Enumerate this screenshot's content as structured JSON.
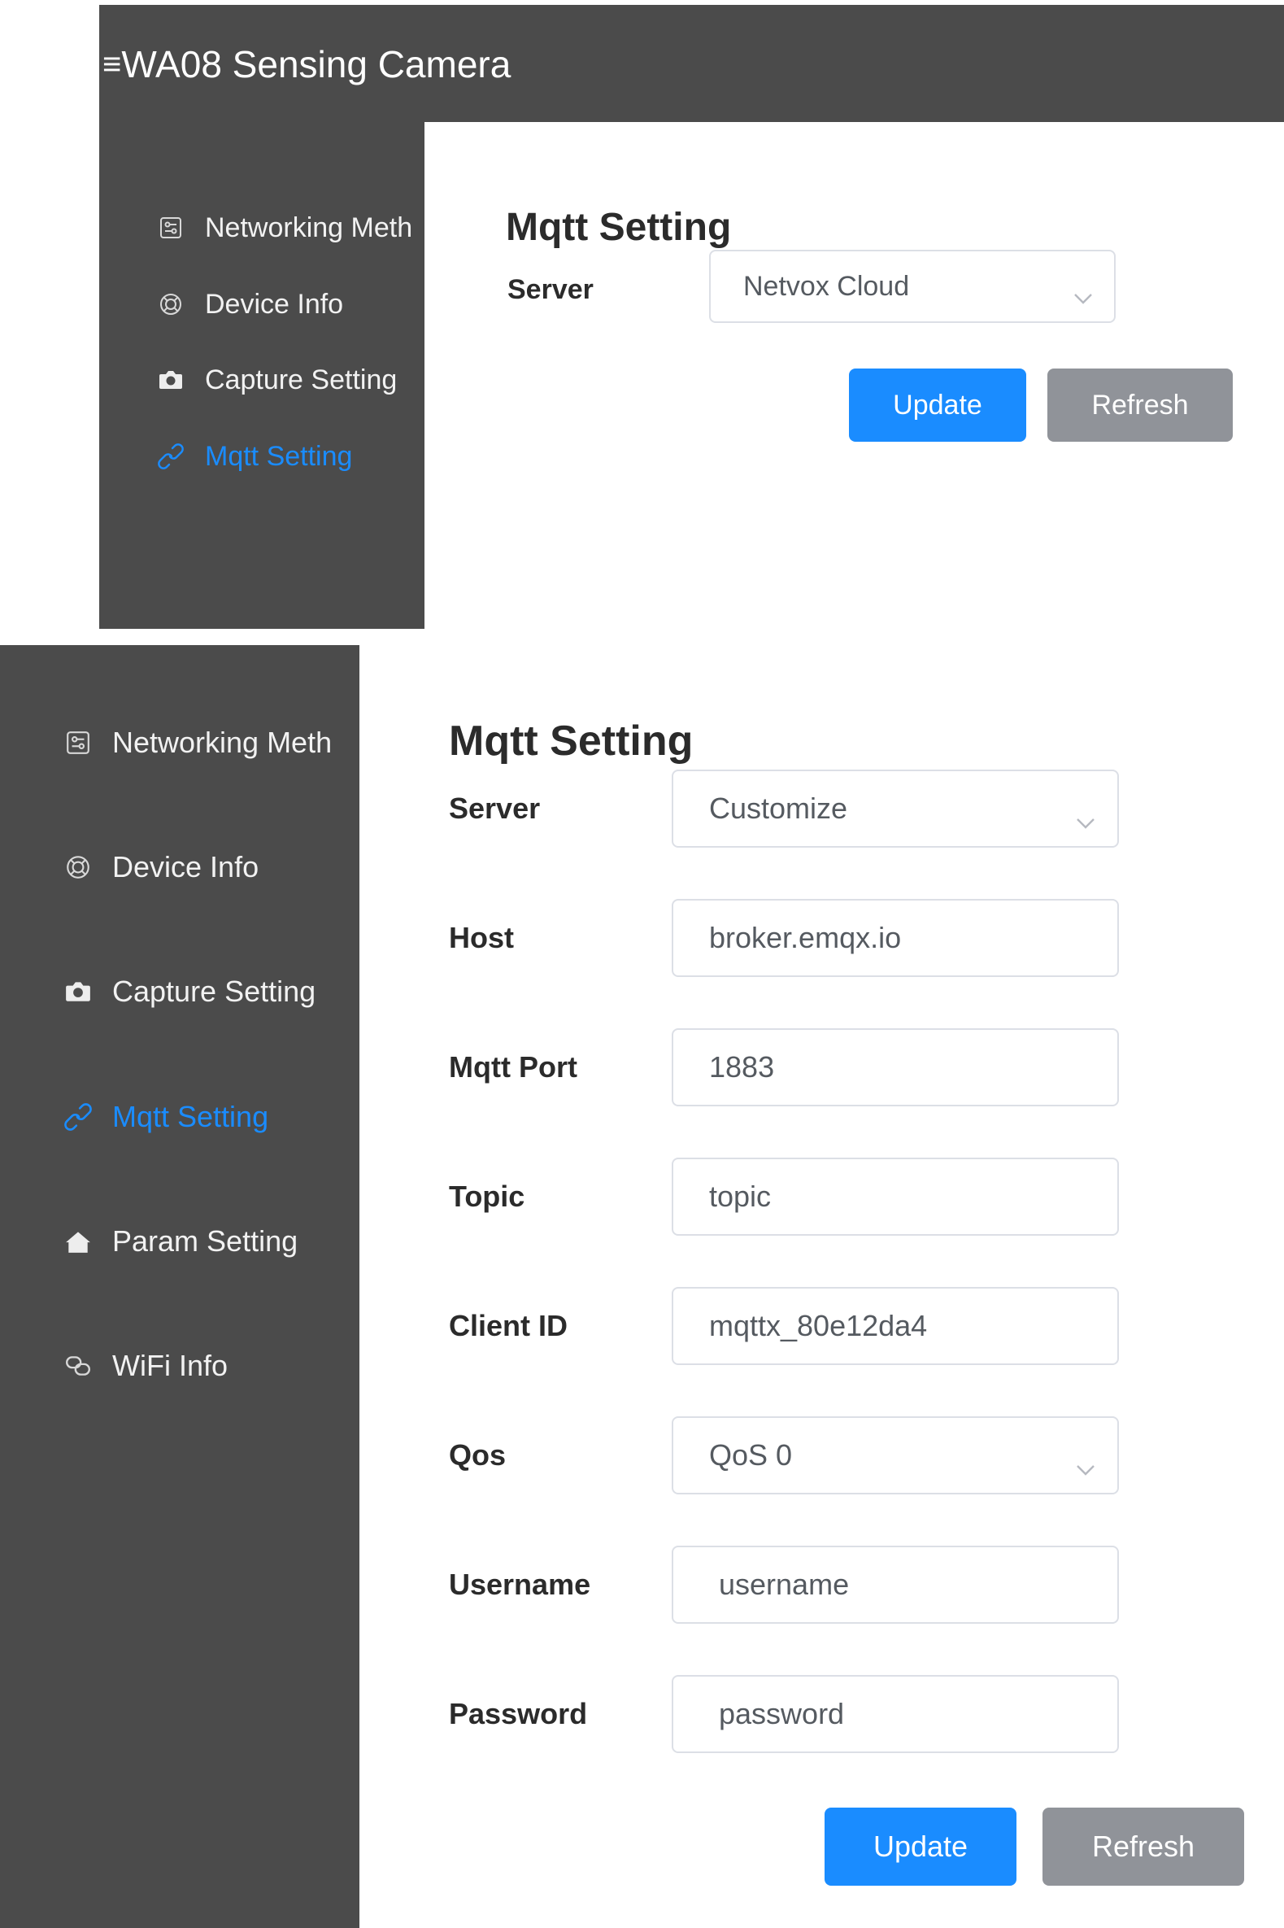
{
  "app": {
    "menu_glyph": "≡",
    "title": "WA08 Sensing Camera"
  },
  "sidebar_top": {
    "items": [
      {
        "label": "Networking Meth",
        "icon": "sliders-icon"
      },
      {
        "label": "Device Info",
        "icon": "lifebuoy-icon"
      },
      {
        "label": "Capture Setting",
        "icon": "camera-icon"
      },
      {
        "label": "Mqtt Setting",
        "icon": "link-icon",
        "active": true
      }
    ]
  },
  "panel_top": {
    "heading": "Mqtt Setting",
    "server_label": "Server",
    "server_value": "Netvox Cloud",
    "update_label": "Update",
    "refresh_label": "Refresh"
  },
  "sidebar_bottom": {
    "items": [
      {
        "label": "Networking Meth",
        "icon": "sliders-icon"
      },
      {
        "label": "Device Info",
        "icon": "lifebuoy-icon"
      },
      {
        "label": "Capture Setting",
        "icon": "camera-icon"
      },
      {
        "label": "Mqtt Setting",
        "icon": "link-icon",
        "active": true
      },
      {
        "label": "Param Setting",
        "icon": "home-icon"
      },
      {
        "label": "WiFi Info",
        "icon": "chain-link-icon"
      }
    ]
  },
  "panel_bottom": {
    "heading": "Mqtt Setting",
    "server": {
      "label": "Server",
      "value": "Customize"
    },
    "host": {
      "label": "Host",
      "value": "broker.emqx.io"
    },
    "port": {
      "label": "Mqtt Port",
      "value": "1883"
    },
    "topic": {
      "label": "Topic",
      "value": "topic"
    },
    "client_id": {
      "label": "Client ID",
      "value": "mqttx_80e12da4"
    },
    "qos": {
      "label": "Qos",
      "value": "QoS 0"
    },
    "username": {
      "label": "Username",
      "value": "username"
    },
    "password": {
      "label": "Password",
      "value": "password"
    },
    "update_label": "Update",
    "refresh_label": "Refresh"
  },
  "colors": {
    "sidebar_bg": "#4b4b4b",
    "accent": "#1a8cff",
    "secondary_button": "#909399",
    "sidebar_text": "#f2f2f2"
  }
}
